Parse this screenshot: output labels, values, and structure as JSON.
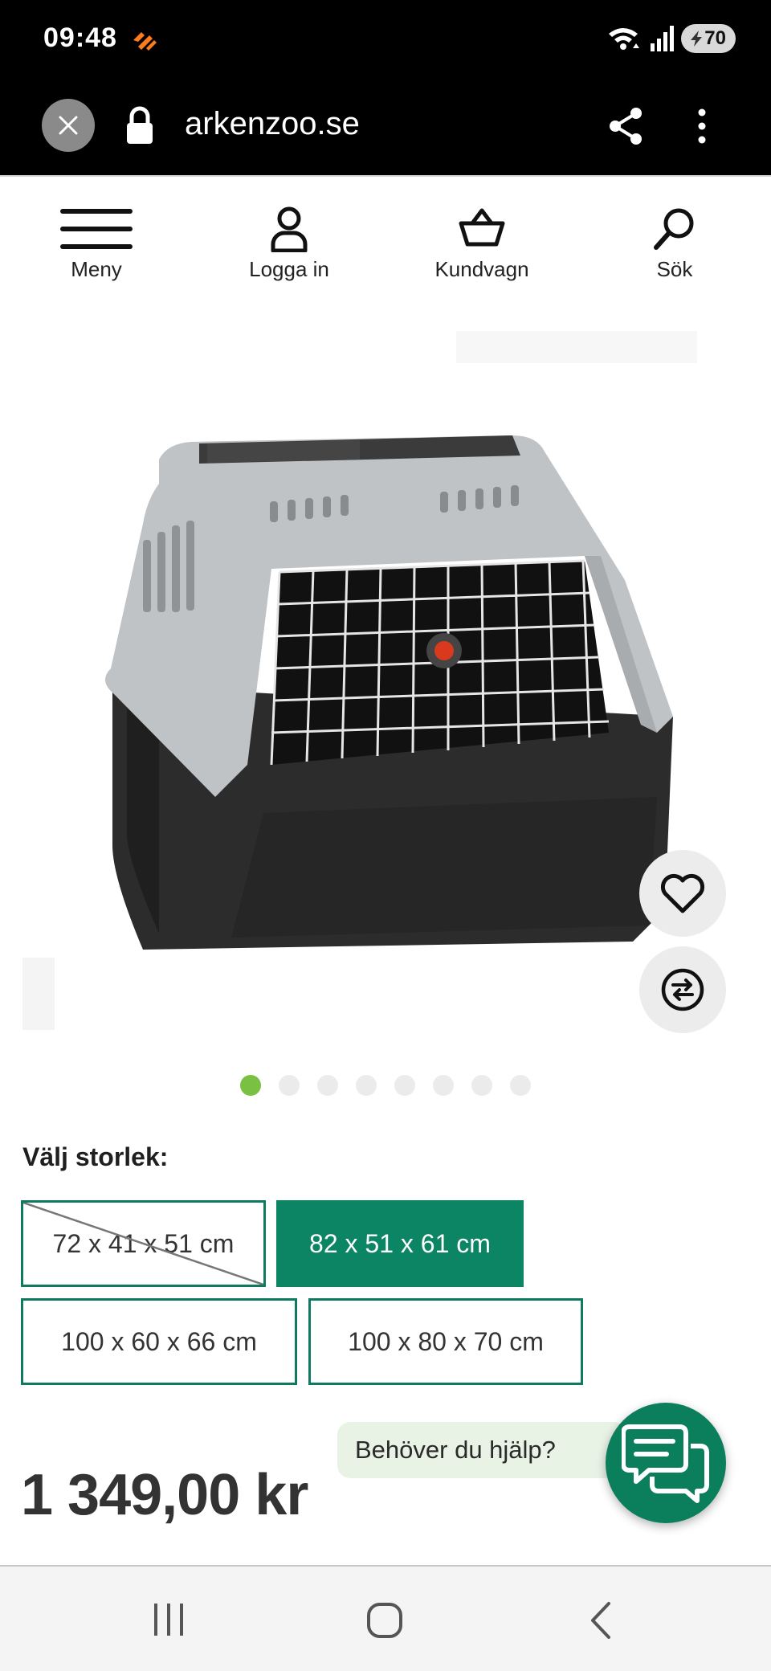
{
  "status_bar": {
    "time": "09:48",
    "battery": "70"
  },
  "browser": {
    "url": "arkenzoo.se"
  },
  "nav": {
    "menu": "Meny",
    "login": "Logga in",
    "cart": "Kundvagn",
    "search": "Sök"
  },
  "carousel": {
    "total": 8,
    "active": 1
  },
  "size_selector": {
    "label": "Välj storlek:",
    "options": [
      {
        "label": "72 x 41 x 51 cm",
        "state": "unavailable"
      },
      {
        "label": "82 x 51 x 61 cm",
        "state": "selected"
      },
      {
        "label": "100 x 60 x 66 cm",
        "state": "available"
      },
      {
        "label": "100 x 80 x 70 cm",
        "state": "available"
      }
    ]
  },
  "price": "1 349,00 kr",
  "help": {
    "text": "Behöver du hjälp?"
  },
  "colors": {
    "brand_green": "#0b8563",
    "dot_active": "#7ac143",
    "help_bubble": "#e8f3e6"
  }
}
